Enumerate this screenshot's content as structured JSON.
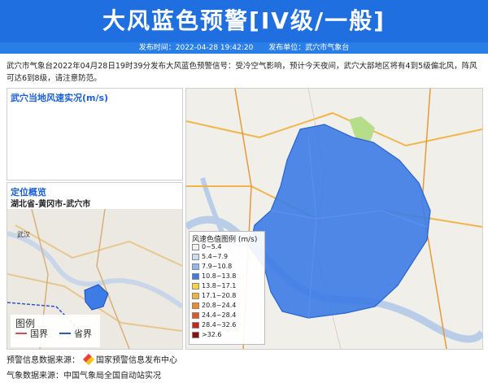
{
  "header": {
    "title": "大风蓝色预警[IV级/一般]",
    "publish_time": "发布时间：2022-04-28 19:42:20",
    "publish_unit": "发布单位：武穴市气象台"
  },
  "description": "武穴市气象台2022年04月28日19时39分发布大风蓝色预警信号：受冷空气影响，预计今天夜间，武穴大部地区将有4到5级偏北风，阵风可达6到8级，请注意防范。",
  "panels": {
    "wind_title": "武穴当地风速实况(m/s)",
    "location_title": "定位概览",
    "location_path": "湖北省-黄冈市-武穴市"
  },
  "wind_legend": {
    "title": "风速色值图例 (m/s)",
    "items": [
      {
        "label": "0~5.4",
        "color": "#f2f2f2"
      },
      {
        "label": "5.4~7.9",
        "color": "#c8ddf6"
      },
      {
        "label": "7.9~10.8",
        "color": "#8fb8f0"
      },
      {
        "label": "10.8~13.8",
        "color": "#3d7be6"
      },
      {
        "label": "13.8~17.1",
        "color": "#f7d43a"
      },
      {
        "label": "17.1~20.8",
        "color": "#f2b33a"
      },
      {
        "label": "20.8~24.4",
        "color": "#ee8a2c"
      },
      {
        "label": "24.4~28.4",
        "color": "#e3561f"
      },
      {
        "label": "28.4~32.6",
        "color": "#c9261b"
      },
      {
        "label": ">32.6",
        "color": "#8b0f10"
      }
    ]
  },
  "map_legend": {
    "title": "图例",
    "items": [
      {
        "label": "国界",
        "color": "#c8515f"
      },
      {
        "label": "省界",
        "color": "#2f55c8"
      }
    ]
  },
  "map_labels": {
    "wuhan": "武汉"
  },
  "footer": {
    "warning_source_label": "预警信息数据来源：",
    "warning_source": "国家预警信息发布中心",
    "weather_source": "气象数据来源：中国气象局全国自动站实况"
  }
}
